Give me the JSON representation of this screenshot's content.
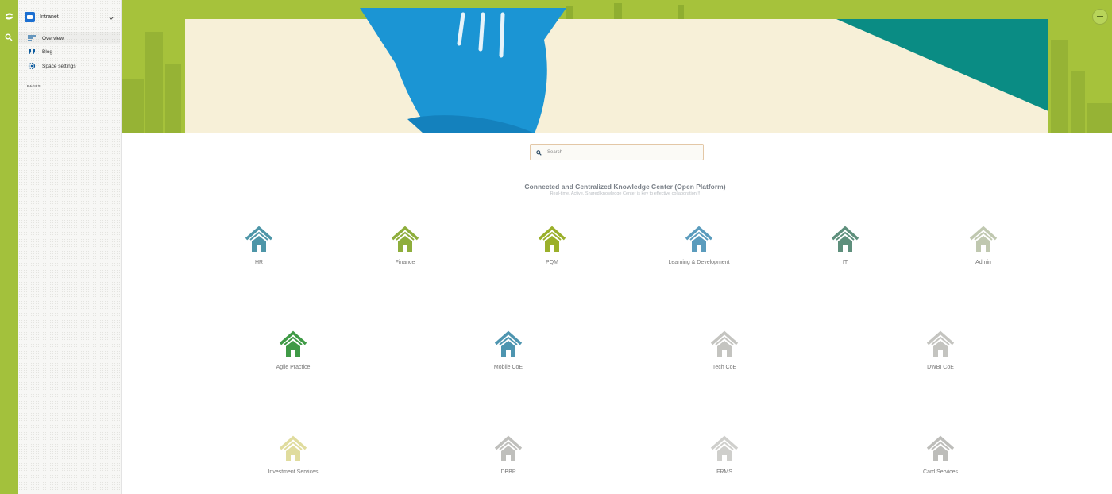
{
  "space": {
    "name": "Intranet",
    "nav": [
      {
        "label": "Overview",
        "icon": "overview-lines-icon",
        "active": true
      },
      {
        "label": "Blog",
        "icon": "quote-icon",
        "active": false
      },
      {
        "label": "Space settings",
        "icon": "gear-icon",
        "active": false
      }
    ],
    "section_label": "PAGES"
  },
  "search": {
    "placeholder": "Search"
  },
  "main": {
    "title": "Connected and Centralized Knowledge Center (Open Platform)",
    "subtitle": "Real-time, Active, Shared knowledge Center is key to effective collaboration !!"
  },
  "tiles": [
    {
      "label": "HR",
      "color": "#4e96a8"
    },
    {
      "label": "Finance",
      "color": "#8eae3c"
    },
    {
      "label": "PQM",
      "color": "#9bb02b"
    },
    {
      "label": "Learning & Development",
      "color": "#5b9cbd"
    },
    {
      "label": "IT",
      "color": "#5e8f7c"
    },
    {
      "label": "Admin",
      "color": "#c0c8b0"
    },
    {
      "label": "Agile Practice",
      "color": "#3f9a46"
    },
    {
      "label": "Mobile CoE",
      "color": "#4e95b0"
    },
    {
      "label": "Tech CoE",
      "color": "#c4c4c0"
    },
    {
      "label": "DWBI CoE",
      "color": "#c4c4c0"
    },
    {
      "label": "Investment Services",
      "color": "#e0dc9e"
    },
    {
      "label": "DBBP",
      "color": "#bfbfbc"
    },
    {
      "label": "FRMS",
      "color": "#cfcfcc"
    },
    {
      "label": "Card Services",
      "color": "#bdbdba"
    }
  ],
  "colors": {
    "rail": "#a3c13c",
    "banner_green": "#a6c23b",
    "banner_cream": "#f7f0d8",
    "banner_hand": "#1b95d4",
    "banner_teal": "#0a8c84"
  }
}
